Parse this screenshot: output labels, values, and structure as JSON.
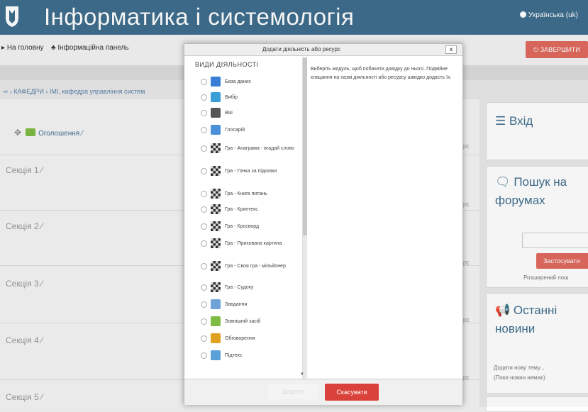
{
  "header": {
    "site_title": "Інформатика і системологія",
    "language": "Українська (uk)"
  },
  "nav": {
    "home": "На головну",
    "dashboard": "Інформаційна панель",
    "finish_edit": "ЗАВЕРШИТИ"
  },
  "breadcrumb": "⇨ › КАФЕДРИ › ІМІ, кафедра управління систем",
  "course": {
    "announce": "Оголошення",
    "sections": [
      "Секція 1",
      "Секція 2",
      "Секція 3",
      "Секція 4",
      "Секція 5"
    ],
    "fragment": "рс"
  },
  "blocks": {
    "login": {
      "title": "Вхід"
    },
    "search": {
      "title_line1": "Пошук на",
      "title_line2": "форумах",
      "button": "Застосувати",
      "advanced": "Розширений пош"
    },
    "news": {
      "title_line1": "Останні",
      "title_line2": "новини",
      "add_topic": "Додати нову тему...",
      "no_news": "(Поки новин немає)"
    }
  },
  "modal": {
    "title": "Додати діяльність або ресурс",
    "close": "x",
    "list_heading": "ВИДИ ДІЯЛЬНОСТІ",
    "description": "Виберіть модуль, щоб побачити довідку до нього. Подвійне клацання на назві діяльності або ресурсу швидко додасть їх.",
    "add_button": "Додати",
    "cancel_button": "Скасувати",
    "activities": [
      {
        "label": "База даних",
        "icon": "database-icon",
        "color": "#3a7fd5"
      },
      {
        "label": "Вибір",
        "icon": "question-icon",
        "color": "#3a9fd9"
      },
      {
        "label": "Вікі",
        "icon": "wiki-icon",
        "color": "#555555"
      },
      {
        "label": "Глосарій",
        "icon": "glossary-icon",
        "color": "#4a90d9"
      },
      {
        "label": "Гра - Анаграма - вгадай слово",
        "icon": "game-icon",
        "color": "#333333"
      },
      {
        "label": "Гра - Гонка за підказки",
        "icon": "game-icon",
        "color": "#333333"
      },
      {
        "label": "Гра - Книга питань",
        "icon": "game-icon",
        "color": "#333333"
      },
      {
        "label": "Гра - Криптекс",
        "icon": "game-icon",
        "color": "#333333"
      },
      {
        "label": "Гра - Кросворд",
        "icon": "game-icon",
        "color": "#333333"
      },
      {
        "label": "Гра - Прихована картина",
        "icon": "game-icon",
        "color": "#333333"
      },
      {
        "label": "Гра - Своя гра - мільйонер",
        "icon": "game-icon",
        "color": "#333333"
      },
      {
        "label": "Гра - Судоку",
        "icon": "game-icon",
        "color": "#333333"
      },
      {
        "label": "Завдання",
        "icon": "assignment-icon",
        "color": "#6fa2d8"
      },
      {
        "label": "Зовнішній засіб",
        "icon": "puzzle-icon",
        "color": "#7dbb42"
      },
      {
        "label": "Обговорення",
        "icon": "chart-icon",
        "color": "#e0a020"
      },
      {
        "label": "Підтекс",
        "icon": "people-icon",
        "color": "#5aa0d8"
      }
    ]
  }
}
